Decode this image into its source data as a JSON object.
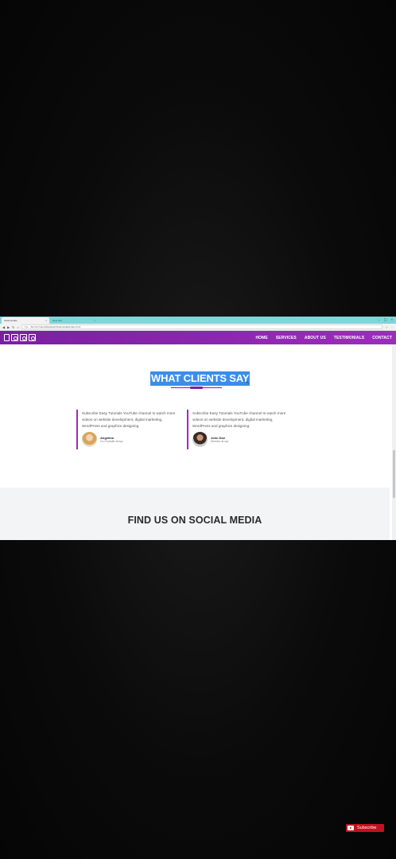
{
  "browser": {
    "tabs": [
      {
        "label": "Testimonials",
        "close": "×"
      },
      {
        "label": "New Tab",
        "close": "×"
      }
    ],
    "window_controls": "– ▢ ×",
    "url": "file:///C:/Users/Desktop/Testimonials/index.html",
    "scheme": "File"
  },
  "nav": {
    "items": [
      "HOME",
      "SERVICES",
      "ABOUT US",
      "TESTIMONIALS",
      "CONTACT"
    ]
  },
  "testimonials": {
    "title": "WHAT CLIENTS SAY",
    "cards": [
      {
        "quote": "Subscribe Easy Tutorials YouTube channel to watch more videos on website development, digital marketing, WordPress and graphics designing.",
        "name": "Angelina",
        "role": "Co-Founder at xyz"
      },
      {
        "quote": "Subscribe Easy Tutorials YouTube channel to watch more videos on website development, digital marketing, WordPress and graphics designing.",
        "name": "John Doe",
        "role": "Director at xyz"
      }
    ]
  },
  "social": {
    "title": "FIND US ON SOCIAL MEDIA"
  },
  "overlay": {
    "subscribe_label": "Subscribe"
  },
  "colors": {
    "brand": "#9b2dbb",
    "highlight": "#3b8ee8",
    "tabbar": "#7fd5d8",
    "subscribe": "#c1121f"
  }
}
